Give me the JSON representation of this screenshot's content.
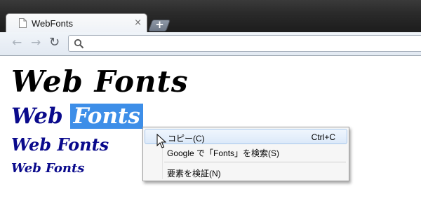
{
  "browser": {
    "tab_title": "WebFonts",
    "tab_close": "×",
    "new_tab": "+",
    "back_glyph": "←",
    "forward_glyph": "→",
    "reload_glyph": "↻",
    "address_value": ""
  },
  "page": {
    "heading_1": "Web Fonts",
    "heading_2_plain": "Web ",
    "heading_2_selected": "Fonts",
    "heading_3": "Web Fonts",
    "heading_4": "Web Fonts"
  },
  "context_menu": {
    "copy_label": "コピー(C)",
    "copy_shortcut": "Ctrl+C",
    "search_label": "Google で「Fonts」を検索(S)",
    "inspect_label": "要素を検証(N)"
  },
  "colors": {
    "selection": "#3d8ee8",
    "heading_blue": "#0a0a8c",
    "frame_dark": "#2b2b2b"
  }
}
